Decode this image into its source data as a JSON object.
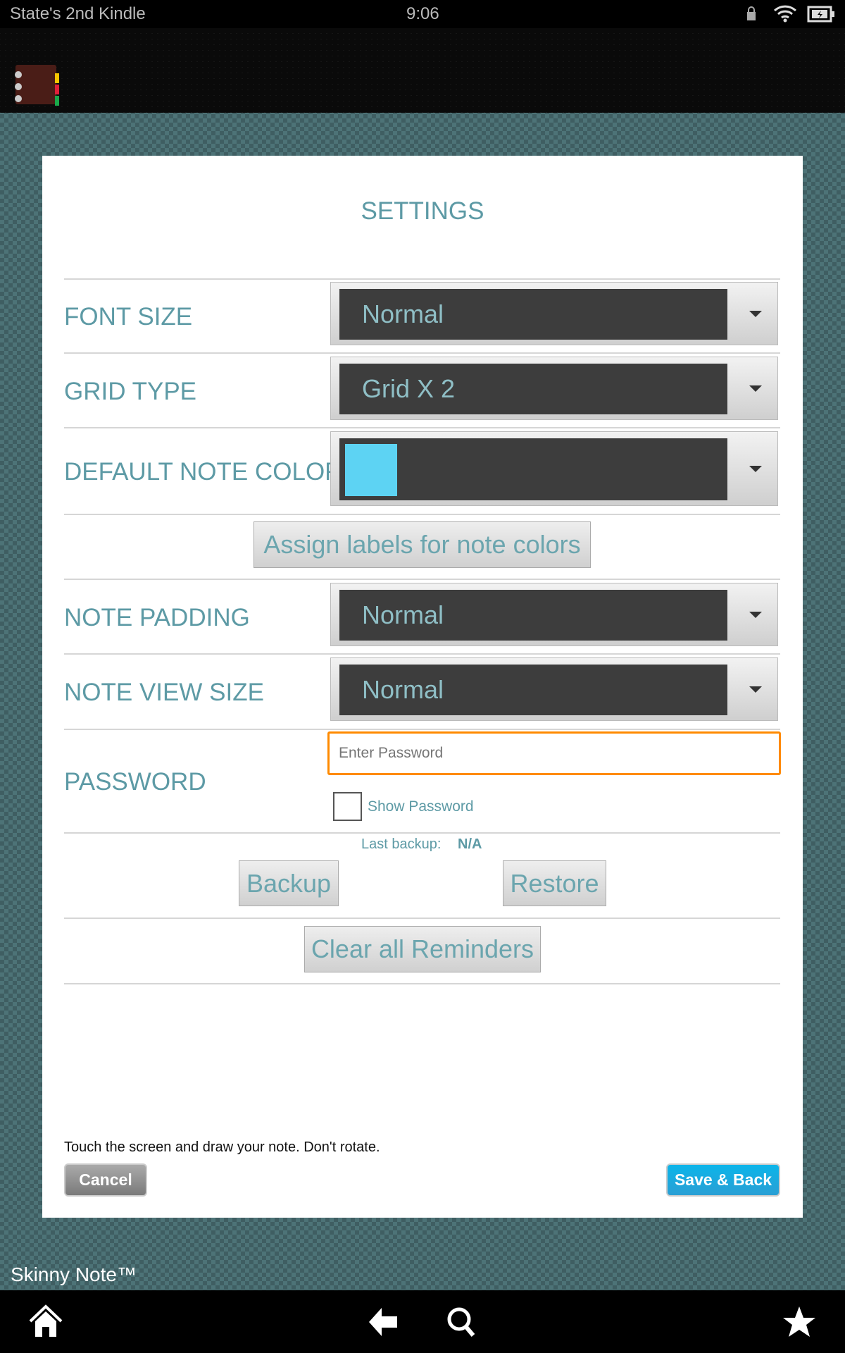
{
  "status_bar": {
    "device_name": "State's 2nd Kindle",
    "time": "9:06",
    "icons": [
      "lock-icon",
      "wifi-icon",
      "battery-charging-icon"
    ]
  },
  "app": {
    "icon": "notebook-app-icon",
    "name": "Skinny Note™"
  },
  "settings": {
    "title": "SETTINGS",
    "font_size": {
      "label": "FONT SIZE",
      "value": "Normal"
    },
    "grid_type": {
      "label": "GRID TYPE",
      "value": "Grid X 2"
    },
    "default_note_color": {
      "label": "DEFAULT NOTE COLOR",
      "value": "#5dd3f3"
    },
    "assign_labels_button": "Assign labels for note colors",
    "note_padding": {
      "label": "NOTE PADDING",
      "value": "Normal"
    },
    "note_view_size": {
      "label": "NOTE VIEW SIZE",
      "value": "Normal"
    },
    "password": {
      "label": "PASSWORD",
      "placeholder": "Enter Password",
      "value": "",
      "show_password_label": "Show Password",
      "show_password_checked": false
    },
    "backup": {
      "last_backup_label": "Last backup:",
      "last_backup_value": "N/A",
      "backup_button": "Backup",
      "restore_button": "Restore"
    },
    "clear_reminders_button": "Clear all Reminders"
  },
  "footer": {
    "hint": "Touch the screen and draw your note. Don't rotate.",
    "cancel": "Cancel",
    "save_back": "Save & Back"
  },
  "nav": {
    "icons": [
      "home-icon",
      "back-icon",
      "search-icon",
      "favorites-star-icon"
    ]
  }
}
